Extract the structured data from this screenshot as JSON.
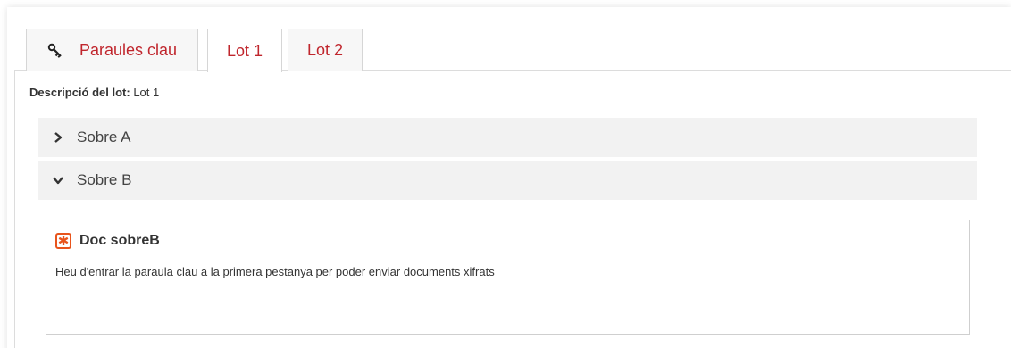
{
  "tabs": [
    {
      "label": "Paraules clau",
      "icon": "key-icon"
    },
    {
      "label": "Lot 1"
    },
    {
      "label": "Lot 2"
    }
  ],
  "active_tab": "Lot 1",
  "description": {
    "label": "Descripció del lot:",
    "value": "Lot 1"
  },
  "sections": [
    {
      "label": "Sobre A",
      "state": "collapsed",
      "icon": "chevron-right-icon"
    },
    {
      "label": "Sobre B",
      "state": "expanded",
      "icon": "chevron-down-icon"
    }
  ],
  "document": {
    "title": "Doc sobreB",
    "icon": "required-icon",
    "message": "Heu d'entrar la paraula clau a la primera pestanya per poder enviar documents xifrats"
  },
  "colors": {
    "tab_text": "#c0262d",
    "required_icon": "#e8541c",
    "accordion_bg": "#f2f2f2"
  }
}
